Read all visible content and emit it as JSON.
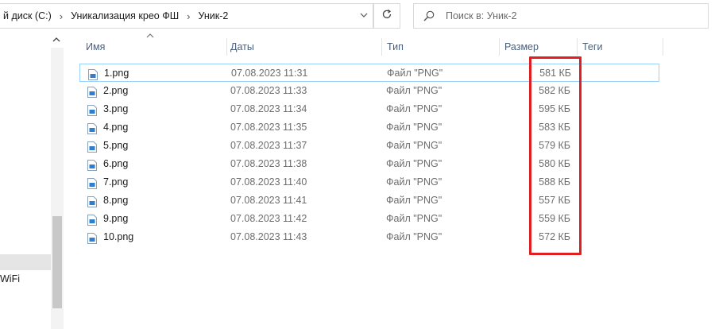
{
  "address": {
    "crumbs": [
      "й диск (C:)",
      "Уникализация крео ФШ",
      "Уник-2"
    ],
    "separator": "›",
    "dropdown_icon": "chevron-down-icon"
  },
  "refresh_icon": "refresh-icon",
  "search": {
    "placeholder": "Поиск в: Уник-2",
    "value": ""
  },
  "nav": {
    "item_label": "WiFi"
  },
  "columns": {
    "name": "Имя",
    "date": "Даты",
    "type": "Тип",
    "size": "Размер",
    "tags": "Теги"
  },
  "files": [
    {
      "name": "1.png",
      "date": "07.08.2023 11:31",
      "type": "Файл \"PNG\"",
      "size": "581 КБ"
    },
    {
      "name": "2.png",
      "date": "07.08.2023 11:33",
      "type": "Файл \"PNG\"",
      "size": "582 КБ"
    },
    {
      "name": "3.png",
      "date": "07.08.2023 11:34",
      "type": "Файл \"PNG\"",
      "size": "595 КБ"
    },
    {
      "name": "4.png",
      "date": "07.08.2023 11:35",
      "type": "Файл \"PNG\"",
      "size": "583 КБ"
    },
    {
      "name": "5.png",
      "date": "07.08.2023 11:37",
      "type": "Файл \"PNG\"",
      "size": "579 КБ"
    },
    {
      "name": "6.png",
      "date": "07.08.2023 11:38",
      "type": "Файл \"PNG\"",
      "size": "580 КБ"
    },
    {
      "name": "7.png",
      "date": "07.08.2023 11:40",
      "type": "Файл \"PNG\"",
      "size": "588 КБ"
    },
    {
      "name": "8.png",
      "date": "07.08.2023 11:41",
      "type": "Файл \"PNG\"",
      "size": "557 КБ"
    },
    {
      "name": "9.png",
      "date": "07.08.2023 11:42",
      "type": "Файл \"PNG\"",
      "size": "559 КБ"
    },
    {
      "name": "10.png",
      "date": "07.08.2023 11:43",
      "type": "Файл \"PNG\"",
      "size": "572 КБ"
    }
  ],
  "colors": {
    "highlight": "#e02020",
    "selection_border": "#99d1ff",
    "header_text": "#4c607a"
  }
}
